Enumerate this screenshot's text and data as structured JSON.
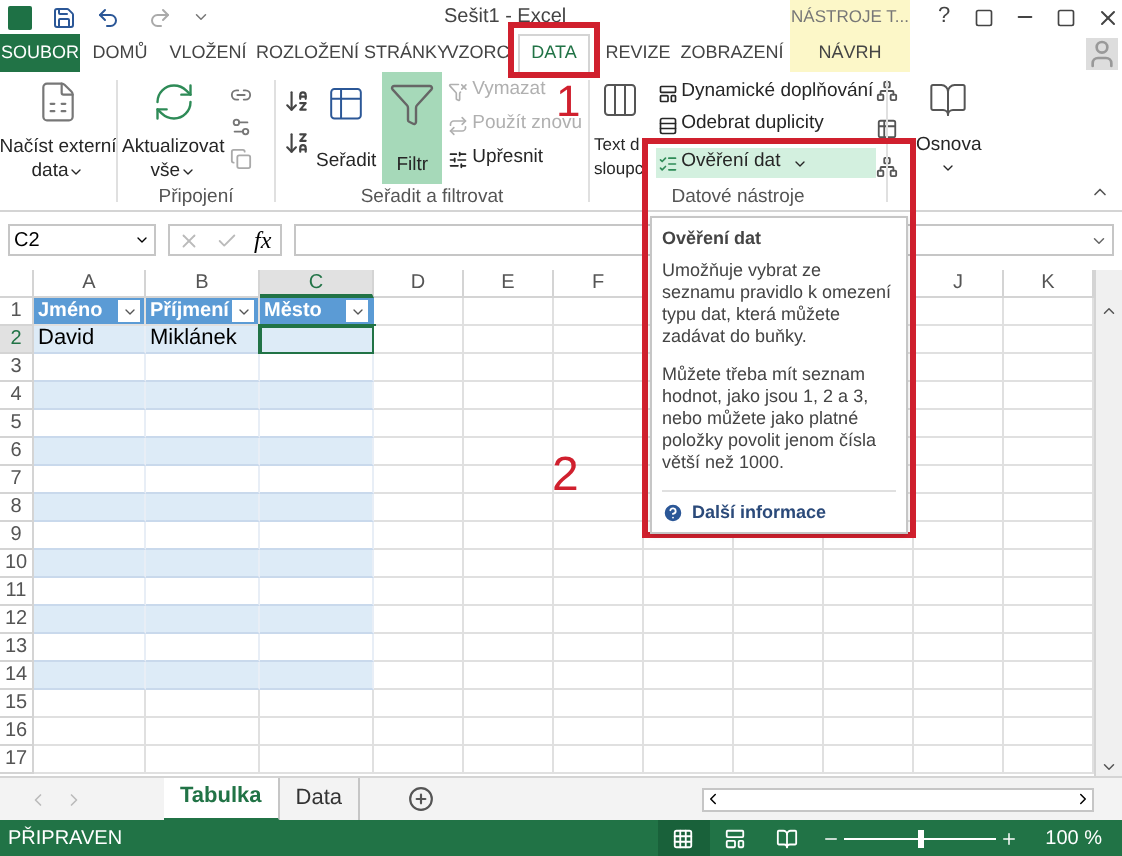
{
  "title_bar": {
    "title": "Sešit1 - Excel",
    "contextual_group": "NÁSTROJE T...",
    "help": "?"
  },
  "ribbon_tabs": [
    {
      "label": "SOUBOR",
      "kind": "file",
      "selected": false
    },
    {
      "label": "DOMŮ",
      "kind": "tab",
      "selected": false
    },
    {
      "label": "VLOŽENÍ",
      "kind": "tab",
      "selected": false
    },
    {
      "label": "ROZLOŽENÍ STRÁNKY",
      "kind": "tab",
      "selected": false
    },
    {
      "label": "VZORC",
      "kind": "tab",
      "selected": false
    },
    {
      "label": "DATA",
      "kind": "tab",
      "selected": true
    },
    {
      "label": "REVIZE",
      "kind": "tab",
      "selected": false
    },
    {
      "label": "ZOBRAZENÍ",
      "kind": "tab",
      "selected": false
    },
    {
      "label": "NÁVRH",
      "kind": "contextual",
      "selected": false
    }
  ],
  "ribbon": {
    "external_data": {
      "line1": "Načíst externí",
      "line2": "data"
    },
    "connections": {
      "refresh_line1": "Aktualizovat",
      "refresh_line2": "vše",
      "label": "Připojení"
    },
    "sort_filter": {
      "sort": "Seřadit",
      "filter": {
        "label": "Filtr",
        "selected": true
      },
      "commands": [
        {
          "label": "Vymazat",
          "disabled": true
        },
        {
          "label": "Použít znovu",
          "disabled": true
        },
        {
          "label": "Upřesnit",
          "disabled": false
        }
      ],
      "label": "Seřadit a filtrovat"
    },
    "data_tools": {
      "text_line1": "Text d",
      "text_line2": "sloupc",
      "commands": [
        {
          "label": "Dynamické doplňování",
          "highlighted": false,
          "dropdown": false
        },
        {
          "label": "Odebrat duplicity",
          "highlighted": false,
          "dropdown": false
        },
        {
          "label": "Ověření dat",
          "highlighted": true,
          "dropdown": true
        }
      ],
      "label": "Datové nástroje"
    },
    "outline": "Osnova"
  },
  "formula_bar": {
    "name_box": "C2",
    "fx": "fx"
  },
  "columns": [
    {
      "label": "A",
      "selected": false
    },
    {
      "label": "B",
      "selected": false
    },
    {
      "label": "C",
      "selected": true
    },
    {
      "label": "D",
      "selected": false
    },
    {
      "label": "E",
      "selected": false
    },
    {
      "label": "F",
      "selected": false
    },
    {
      "label": "J",
      "selected": false
    },
    {
      "label": "K",
      "selected": false
    }
  ],
  "rows": [
    {
      "number": "1",
      "kind": "table-header",
      "cells": [
        {
          "text": "Jméno"
        },
        {
          "text": "Příjmení"
        },
        {
          "text": "Město"
        }
      ]
    },
    {
      "number": "2",
      "kind": "table-row",
      "cells": [
        {
          "text": "David",
          "selected": false
        },
        {
          "text": "Miklánek",
          "selected": false
        },
        {
          "selected": true
        }
      ]
    },
    {
      "number": "3",
      "kind": "table-row"
    },
    {
      "number": "4",
      "kind": "table-row"
    },
    {
      "number": "5",
      "kind": "table-row"
    },
    {
      "number": "6",
      "kind": "table-row"
    },
    {
      "number": "7",
      "kind": "table-row"
    },
    {
      "number": "8",
      "kind": "table-row"
    },
    {
      "number": "9",
      "kind": "table-row"
    },
    {
      "number": "10",
      "kind": "table-row"
    },
    {
      "number": "11",
      "kind": "table-row"
    },
    {
      "number": "12",
      "kind": "table-row"
    },
    {
      "number": "13",
      "kind": "table-row"
    },
    {
      "number": "14",
      "kind": "table-row"
    },
    {
      "number": "15",
      "kind": "plain"
    },
    {
      "number": "16",
      "kind": "plain"
    },
    {
      "number": "17",
      "kind": "plain"
    }
  ],
  "tooltip": {
    "title": "Ověření dat",
    "paragraphs": [
      "Umožňuje vybrat ze seznamu pravidlo k omezení typu dat, která můžete zadávat do buňky.",
      "Můžete třeba mít seznam hodnot, jako jsou 1, 2 a 3, nebo můžete jako platné položky povolit jenom čísla větší než 1000."
    ],
    "link": "Další informace"
  },
  "annotations": [
    {
      "label": "1"
    },
    {
      "label": "2"
    }
  ],
  "sheet_tabs": [
    {
      "label": "Tabulka",
      "selected": true
    },
    {
      "label": "Data",
      "selected": false
    }
  ],
  "status_bar": {
    "text": "PŘIPRAVEN",
    "views": [
      {
        "selected": true
      },
      {
        "selected": false
      },
      {
        "selected": false
      }
    ],
    "zoom": {
      "level": 0.5,
      "text": "100 %"
    }
  }
}
